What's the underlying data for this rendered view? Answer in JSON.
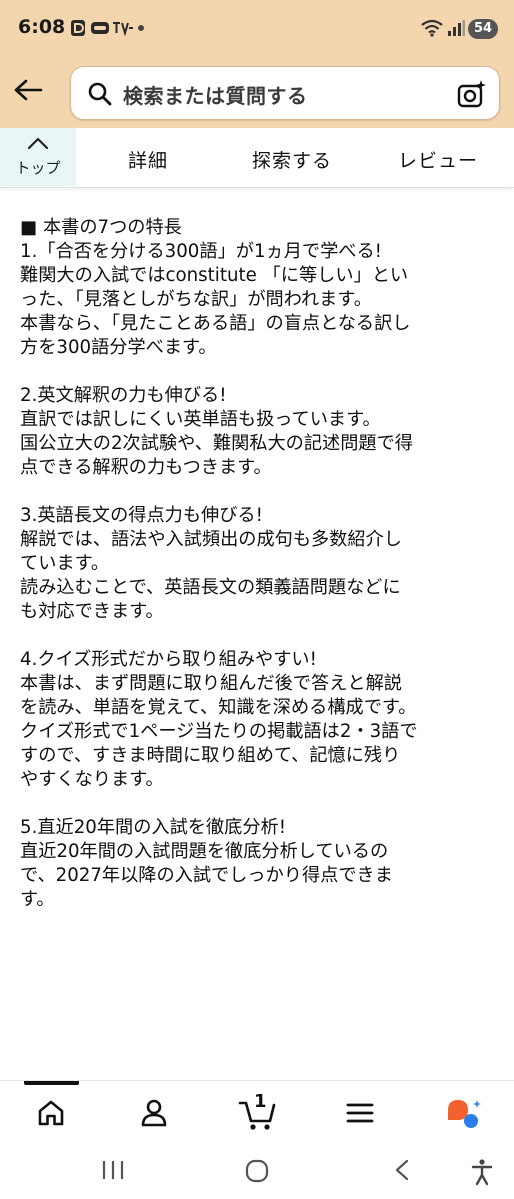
{
  "status_bar": {
    "time": "6:08",
    "battery": "54"
  },
  "header": {
    "search_placeholder": "検索または質問する"
  },
  "tabs": {
    "top_label": "トップ",
    "items": [
      "詳細",
      "探索する",
      "レビュー"
    ]
  },
  "content": {
    "lines": [
      "■ 本書の7つの特長",
      "1.「合否を分ける300語」が1ヵ月で学べる!",
      "難関大の入試ではconstitute 「に等しい」とい",
      "った、「見落としがちな訳」が問われます。",
      "本書なら、「見たことある語」の盲点となる訳し",
      "方を300語分学べます。",
      "",
      "2.英文解釈の力も伸びる!",
      "直訳では訳しにくい英単語も扱っています。",
      "国公立大の2次試験や、難関私大の記述問題で得",
      "点できる解釈の力もつきます。",
      "",
      "3.英語長文の得点力も伸びる!",
      "解説では、語法や入試頻出の成句も多数紹介し",
      "ています。",
      "読み込むことで、英語長文の類義語問題などに",
      "も対応できます。",
      "",
      "4.クイズ形式だから取り組みやすい!",
      "本書は、まず問題に取り組んだ後で答えと解説",
      "を読み、単語を覚えて、知識を深める構成です。",
      "クイズ形式で1ページ当たりの掲載語は2・3語で",
      "すので、すきま時間に取り組めて、記憶に残り",
      "やすくなります。",
      "",
      "5.直近20年間の入試を徹底分析!",
      "直近20年間の入試問題を徹底分析しているの",
      "で、2027年以降の入試でしっかり得点できま",
      "す。"
    ]
  },
  "bottom_nav": {
    "cart_count": "1",
    "items": [
      {
        "icon": "home-icon"
      },
      {
        "icon": "account-icon"
      },
      {
        "icon": "cart-icon"
      },
      {
        "icon": "menu-icon"
      },
      {
        "icon": "assistant-icon"
      }
    ]
  },
  "colors": {
    "header_bg": "#f3d6ae",
    "top_tab_bg": "#e9f6f6",
    "assistant_orange": "#f2612e",
    "assistant_blue": "#2b7de9"
  }
}
